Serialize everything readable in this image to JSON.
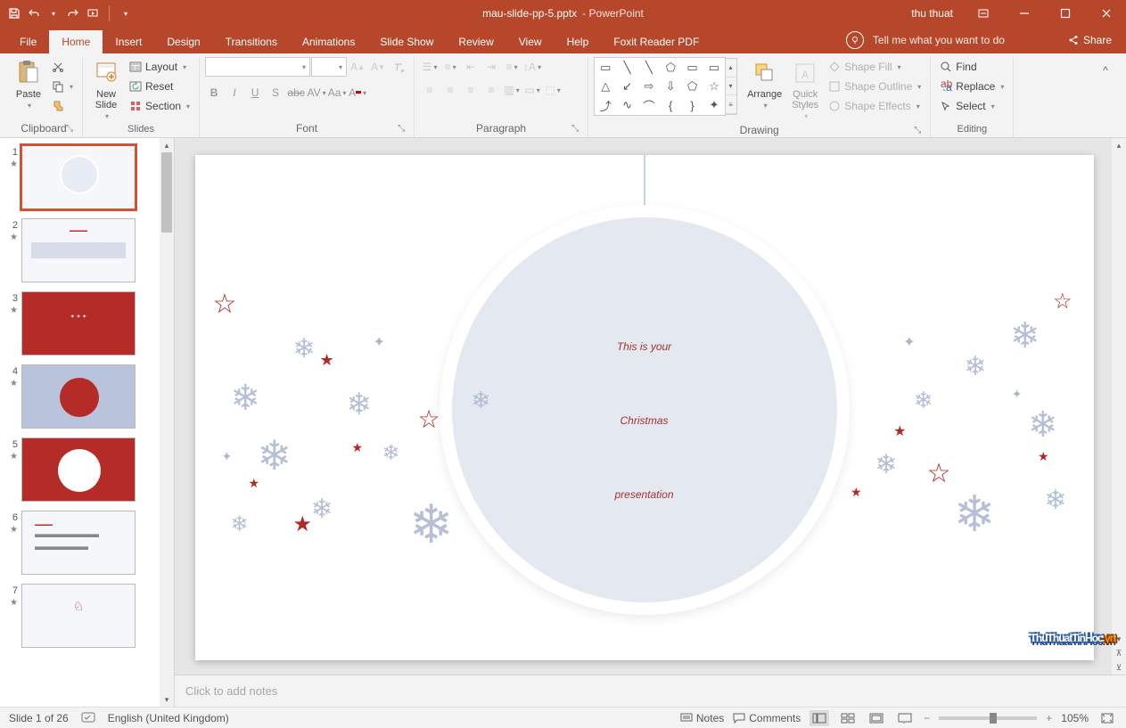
{
  "title": {
    "filename": "mau-slide-pp-5.pptx",
    "app": " - PowerPoint",
    "user": "thu thuat"
  },
  "tabs": {
    "file": "File",
    "home": "Home",
    "insert": "Insert",
    "design": "Design",
    "transitions": "Transitions",
    "animations": "Animations",
    "slideshow": "Slide Show",
    "review": "Review",
    "view": "View",
    "help": "Help",
    "foxit": "Foxit Reader PDF",
    "tellme": "Tell me what you want to do",
    "share": "Share"
  },
  "ribbon": {
    "clipboard": {
      "label": "Clipboard",
      "paste": "Paste"
    },
    "slides": {
      "label": "Slides",
      "newslide": "New\nSlide",
      "layout": "Layout",
      "reset": "Reset",
      "section": "Section"
    },
    "font": {
      "label": "Font"
    },
    "paragraph": {
      "label": "Paragraph"
    },
    "drawing": {
      "label": "Drawing",
      "arrange": "Arrange",
      "quick": "Quick\nStyles",
      "shapefill": "Shape Fill",
      "shapeoutline": "Shape Outline",
      "shapeeffects": "Shape Effects"
    },
    "editing": {
      "label": "Editing",
      "find": "Find",
      "replace": "Replace",
      "select": "Select"
    }
  },
  "slides_panel": {
    "items": [
      {
        "num": "1"
      },
      {
        "num": "2"
      },
      {
        "num": "3"
      },
      {
        "num": "4"
      },
      {
        "num": "5"
      },
      {
        "num": "6"
      },
      {
        "num": "7"
      }
    ]
  },
  "canvas": {
    "title_line1": "This is your",
    "title_line2": "Christmas",
    "title_line3": "presentation"
  },
  "notes": {
    "placeholder": "Click to add notes"
  },
  "status": {
    "slide": "Slide 1 of 26",
    "lang": "English (United Kingdom)",
    "notes": "Notes",
    "comments": "Comments",
    "zoom": "105%"
  },
  "watermark": {
    "part1": "ThuThuatTinHoc",
    "part2": ".vn"
  }
}
